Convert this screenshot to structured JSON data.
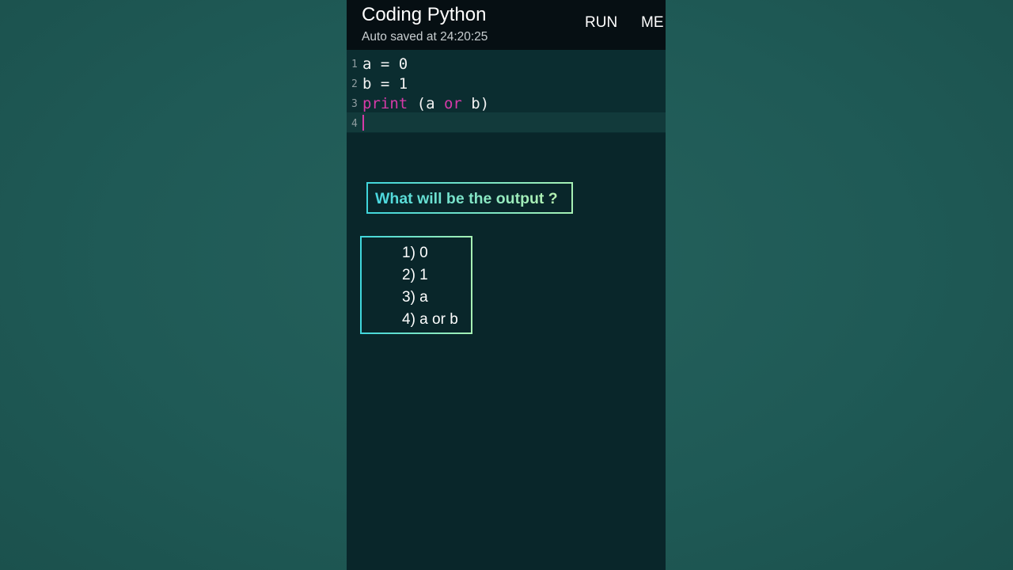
{
  "app": {
    "title": "Coding Python",
    "subtitle": "Auto saved at 24:20:25",
    "run_label": "RUN",
    "menu_label": "ME"
  },
  "editor": {
    "lines": [
      {
        "number": "1",
        "code": "a = 0"
      },
      {
        "number": "2",
        "code": "b = 1"
      },
      {
        "number": "3",
        "keyword1": "print",
        "mid1": " (a ",
        "keyword2": "or",
        "end": " b)"
      },
      {
        "number": "4",
        "code": ""
      }
    ],
    "keyword_color": "#d63aa8"
  },
  "quiz": {
    "question": "What will be the output ?",
    "options": [
      "1) 0",
      "2) 1",
      "3) a",
      "4) a or b"
    ],
    "accent_gradient": [
      "#40d6dc",
      "#a6f0b4"
    ]
  }
}
